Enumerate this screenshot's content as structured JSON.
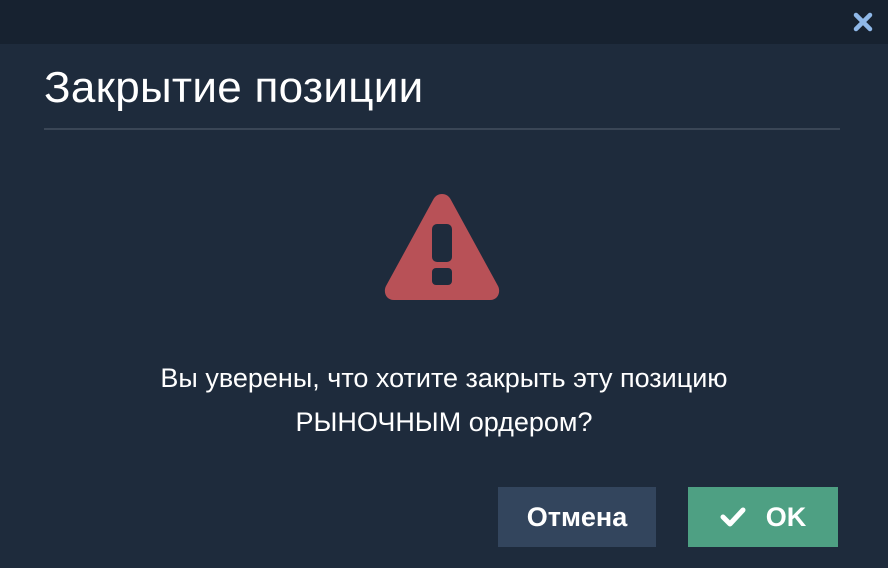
{
  "dialog": {
    "title": "Закрытие позиции",
    "message_line1": "Вы уверены, что хотите закрыть эту позицию",
    "message_line2": "РЫНОЧНЫМ ордером?",
    "cancel_label": "Отмена",
    "ok_label": "OK",
    "close_icon": "close-icon",
    "warning_icon": "warning-triangle-icon",
    "check_icon": "check-icon"
  },
  "colors": {
    "background": "#1e2b3c",
    "topbar": "#172230",
    "close_icon": "#8fb8e8",
    "warning": "#b85157",
    "cancel_button": "#33455d",
    "ok_button": "#4ea083",
    "text": "#ffffff"
  }
}
